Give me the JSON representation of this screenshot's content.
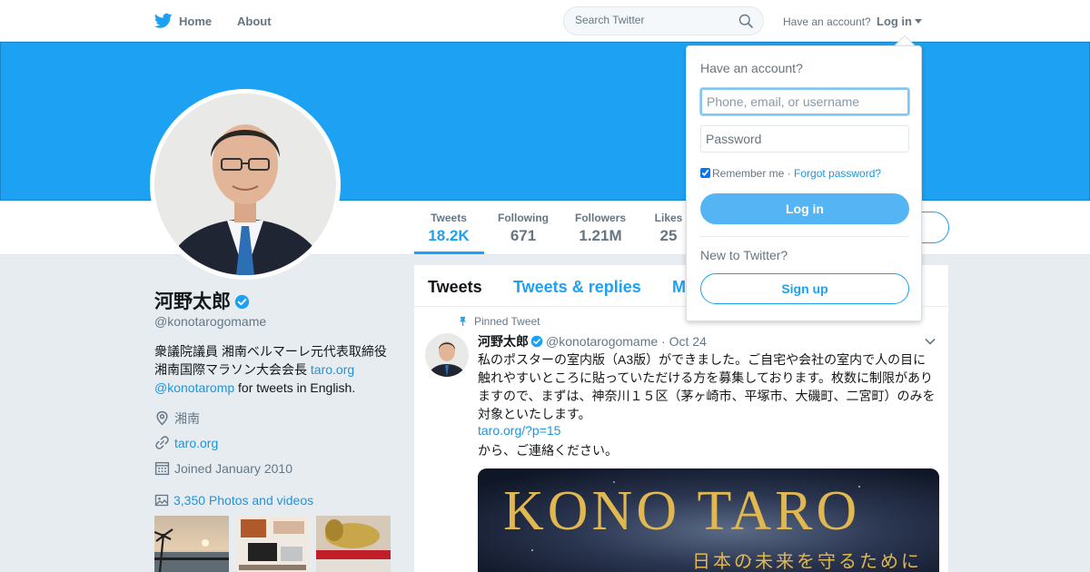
{
  "nav": {
    "home_label": "Home",
    "about_label": "About",
    "search_placeholder": "Search Twitter",
    "have_account": "Have an account?",
    "login_label": "Log in"
  },
  "stats": [
    {
      "label": "Tweets",
      "value": "18.2K"
    },
    {
      "label": "Following",
      "value": "671"
    },
    {
      "label": "Followers",
      "value": "1.21M"
    },
    {
      "label": "Likes",
      "value": "25"
    }
  ],
  "profile": {
    "name": "河野太郎",
    "handle": "@konotarogomame",
    "bio_line1": "衆議院議員 湘南ベルマーレ元代表取締役",
    "bio_line2": "湘南国際マラソン大会会長 ",
    "bio_link1": "taro.org",
    "bio_link2": "@konotaromp",
    "bio_after": " for tweets in English.",
    "location": "湘南",
    "website": "taro.org",
    "joined": "Joined January 2010",
    "photos_label": "3,350 Photos and videos"
  },
  "timeline": {
    "tabs": [
      "Tweets",
      "Tweets & replies",
      "M"
    ]
  },
  "tweet": {
    "pinned_label": "Pinned Tweet",
    "name": "河野太郎",
    "handle": "@konotarogomame",
    "dot": " · ",
    "date": "Oct 24",
    "text_lines": [
      "私のポスターの室内版（A3版）ができました。ご自宅や会社の室内で人の目に",
      "触れやすいところに貼っていただける方を募集しております。枚数に制限があり",
      "ますので、まずは、神奈川１５区（茅ヶ崎市、平塚市、大磯町、二宮町）のみを",
      "対象といたします。"
    ],
    "link": "taro.org/?p=15",
    "after_link": "から、ご連絡ください。",
    "media_title": "KONO TARO",
    "media_subtitle": "日本の未来を守るために"
  },
  "login_dropdown": {
    "heading": "Have an account?",
    "username_placeholder": "Phone, email, or username",
    "password_placeholder": "Password",
    "remember_label": "Remember me",
    "sep": " · ",
    "forgot_label": "Forgot password?",
    "login_button": "Log in",
    "new_label": "New to Twitter?",
    "signup_button": "Sign up"
  },
  "colors": {
    "accent": "#1da1f2",
    "banner": "#1da1f2",
    "link": "#1b95e0"
  },
  "icons": [
    "twitter-bird-icon",
    "search-icon",
    "verified-icon",
    "location-icon",
    "link-icon",
    "calendar-icon",
    "photos-icon",
    "pin-icon",
    "chevron-down-icon"
  ]
}
